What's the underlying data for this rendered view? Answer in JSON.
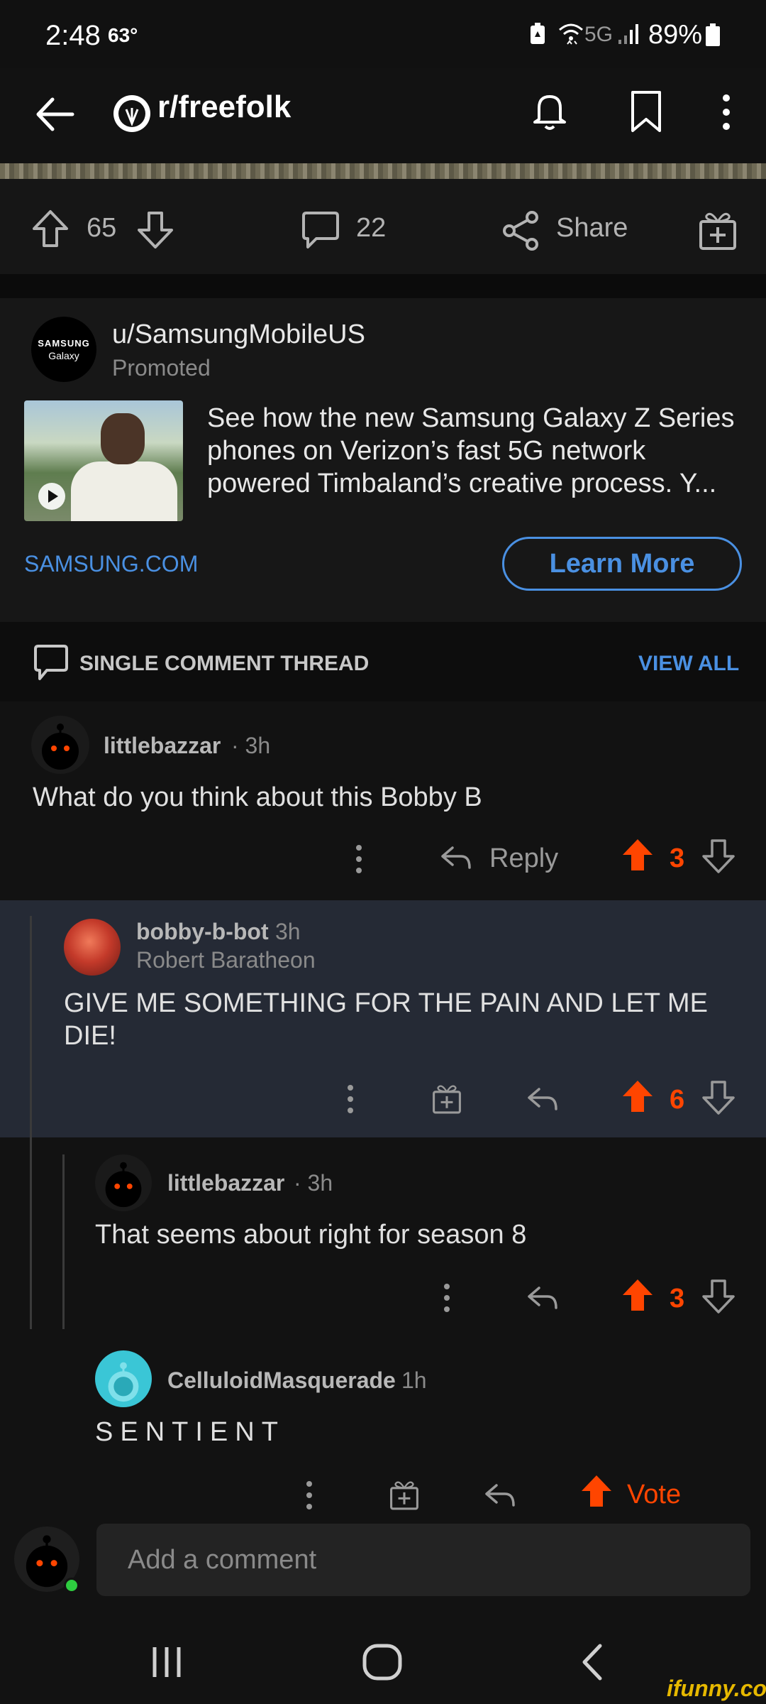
{
  "status_bar": {
    "time": "2:48",
    "temperature": "63°",
    "network": "5G",
    "battery": "89%"
  },
  "header": {
    "subreddit": "r/freefolk",
    "icons": [
      "back-arrow-icon",
      "subreddit-icon",
      "bell-icon",
      "bookmark-icon",
      "more-vertical-icon"
    ]
  },
  "post_actions": {
    "upvotes": "65",
    "comments": "22",
    "share_label": "Share"
  },
  "promoted": {
    "username": "u/SamsungMobileUS",
    "label": "Promoted",
    "avatar_line1": "SAMSUNG",
    "avatar_line2": "Galaxy",
    "text": "See how the new Samsung Galaxy Z Series phones on Verizon’s fast 5G network powered Timbaland’s creative process. Y...",
    "domain": "SAMSUNG.COM",
    "cta": "Learn More"
  },
  "thread": {
    "label": "SINGLE COMMENT THREAD",
    "view_all": "VIEW ALL"
  },
  "comments": [
    {
      "username": "littlebazzar",
      "time": "· 3h",
      "body": "What do you think about this Bobby B",
      "reply_label": "Reply",
      "score": "3"
    },
    {
      "username": "bobby-b-bot",
      "time": "3h",
      "flair": "Robert Baratheon",
      "body": "GIVE ME SOMETHING FOR THE PAIN AND LET ME DIE!",
      "score": "6"
    },
    {
      "username": "littlebazzar",
      "time": "· 3h",
      "body": "That seems about right for season 8",
      "score": "3"
    },
    {
      "username": "CelluloidMasquerade",
      "time": "1h",
      "body": "SENTIENT",
      "score": "Vote"
    }
  ],
  "composer": {
    "placeholder": "Add a comment"
  },
  "colors": {
    "upvote": "#ff4500",
    "link": "#4a90e2",
    "highlight": "#252a35",
    "online": "#2ecc40"
  },
  "watermark": "ifunny.co"
}
